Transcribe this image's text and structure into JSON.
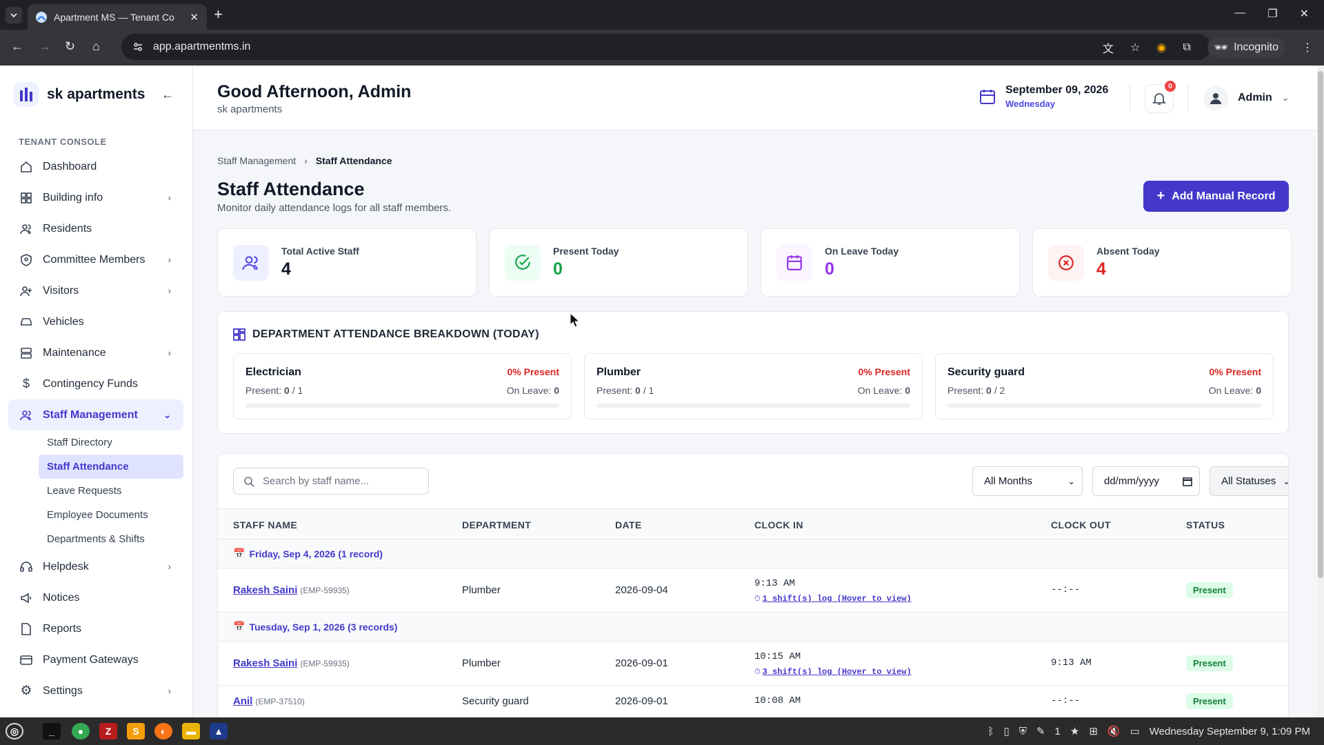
{
  "browser": {
    "tab_title": "Apartment MS — Tenant Co",
    "url": "app.apartmentms.in",
    "incognito_label": "Incognito"
  },
  "sidebar": {
    "brand": "sk apartments",
    "section_label": "TENANT CONSOLE",
    "items": [
      {
        "label": "Dashboard",
        "icon": "home-icon"
      },
      {
        "label": "Building info",
        "icon": "grid-icon"
      },
      {
        "label": "Residents",
        "icon": "users-icon"
      },
      {
        "label": "Committee Members",
        "icon": "shield-icon"
      },
      {
        "label": "Visitors",
        "icon": "user-plus-icon"
      },
      {
        "label": "Vehicles",
        "icon": "car-icon"
      },
      {
        "label": "Maintenance",
        "icon": "server-icon"
      },
      {
        "label": "Contingency Funds",
        "icon": "dollar-icon"
      },
      {
        "label": "Staff Management",
        "icon": "users-icon"
      },
      {
        "label": "Helpdesk",
        "icon": "headset-icon"
      },
      {
        "label": "Notices",
        "icon": "megaphone-icon"
      },
      {
        "label": "Reports",
        "icon": "file-icon"
      },
      {
        "label": "Payment Gateways",
        "icon": "card-icon"
      },
      {
        "label": "Settings",
        "icon": "gear-icon"
      }
    ],
    "sub_items": [
      "Staff Directory",
      "Staff Attendance",
      "Leave Requests",
      "Employee Documents",
      "Departments & Shifts"
    ]
  },
  "header": {
    "greeting": "Good Afternoon, Admin",
    "org": "sk apartments",
    "date": "September 09, 2026",
    "weekday": "Wednesday",
    "notifications": "0",
    "user": "Admin"
  },
  "page": {
    "breadcrumb_parent": "Staff Management",
    "breadcrumb_current": "Staff Attendance",
    "title": "Staff Attendance",
    "subtitle": "Monitor daily attendance logs for all staff members.",
    "add_button": "Add Manual Record"
  },
  "stats": [
    {
      "label": "Total Active Staff",
      "value": "4",
      "color": "#111827",
      "bg": "#eef0ff",
      "icon_color": "#4f46e5"
    },
    {
      "label": "Present Today",
      "value": "0",
      "color": "#16a34a",
      "bg": "#ecfdf3",
      "icon_color": "#16a34a"
    },
    {
      "label": "On Leave Today",
      "value": "0",
      "color": "#9333ea",
      "bg": "#faf5ff",
      "icon_color": "#9333ea"
    },
    {
      "label": "Absent Today",
      "value": "4",
      "color": "#dc2626",
      "bg": "#fef2f2",
      "icon_color": "#dc2626"
    }
  ],
  "departments": {
    "title": "DEPARTMENT ATTENDANCE BREAKDOWN (TODAY)",
    "present_prefix": "Present:",
    "leave_prefix": "On Leave:",
    "items": [
      {
        "name": "Electrician",
        "pct": "0% Present",
        "present": "0",
        "total": "/ 1",
        "leave": "0",
        "fill": 0
      },
      {
        "name": "Plumber",
        "pct": "0% Present",
        "present": "0",
        "total": "/ 1",
        "leave": "0",
        "fill": 0
      },
      {
        "name": "Security guard",
        "pct": "0% Present",
        "present": "0",
        "total": "/ 2",
        "leave": "0",
        "fill": 0
      }
    ]
  },
  "filters": {
    "search_placeholder": "Search by staff name...",
    "months": "All Months",
    "date_placeholder": "dd/mm/yyyy",
    "statuses": "All Statuses"
  },
  "table": {
    "headers": [
      "STAFF NAME",
      "DEPARTMENT",
      "DATE",
      "CLOCK IN",
      "CLOCK OUT",
      "STATUS"
    ],
    "groups": [
      {
        "label": "Friday, Sep 4, 2026 (1 record)",
        "rows": [
          {
            "name": "Rakesh Saini",
            "emp": "(EMP-59935)",
            "dept": "Plumber",
            "date": "2026-09-04",
            "clock_in": "9:13 AM",
            "shift_log": "1 shift(s) log (Hover to view)",
            "clock_out": "--:--",
            "status": "Present"
          }
        ]
      },
      {
        "label": "Tuesday, Sep 1, 2026 (3 records)",
        "rows": [
          {
            "name": "Rakesh Saini",
            "emp": "(EMP-59935)",
            "dept": "Plumber",
            "date": "2026-09-01",
            "clock_in": "10:15 AM",
            "shift_log": "3 shift(s) log (Hover to view)",
            "clock_out": "9:13 AM",
            "status": "Present"
          },
          {
            "name": "Anil",
            "emp": "(EMP-37510)",
            "dept": "Security guard",
            "date": "2026-09-01",
            "clock_in": "10:08 AM",
            "shift_log": "",
            "clock_out": "--:--",
            "status": "Present"
          }
        ]
      }
    ]
  },
  "taskbar": {
    "clock": "Wednesday September 9, 1:09 PM",
    "tray_count": "1"
  }
}
